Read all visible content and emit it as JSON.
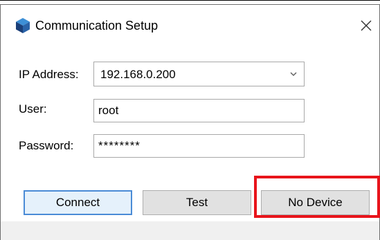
{
  "window": {
    "title": "Communication Setup",
    "icon": "cube-icon",
    "close_icon": "close-icon"
  },
  "form": {
    "ip_label": "IP Address:",
    "ip_value": "192.168.0.200",
    "user_label": "User:",
    "user_value": "root",
    "password_label": "Password:",
    "password_value": "********"
  },
  "buttons": {
    "connect": "Connect",
    "test": "Test",
    "no_device": "No Device"
  },
  "colors": {
    "highlight": "#e8141b",
    "default_button_border": "#4a8bd6",
    "icon_dark": "#1b3f78",
    "icon_light": "#3d8fd6"
  }
}
